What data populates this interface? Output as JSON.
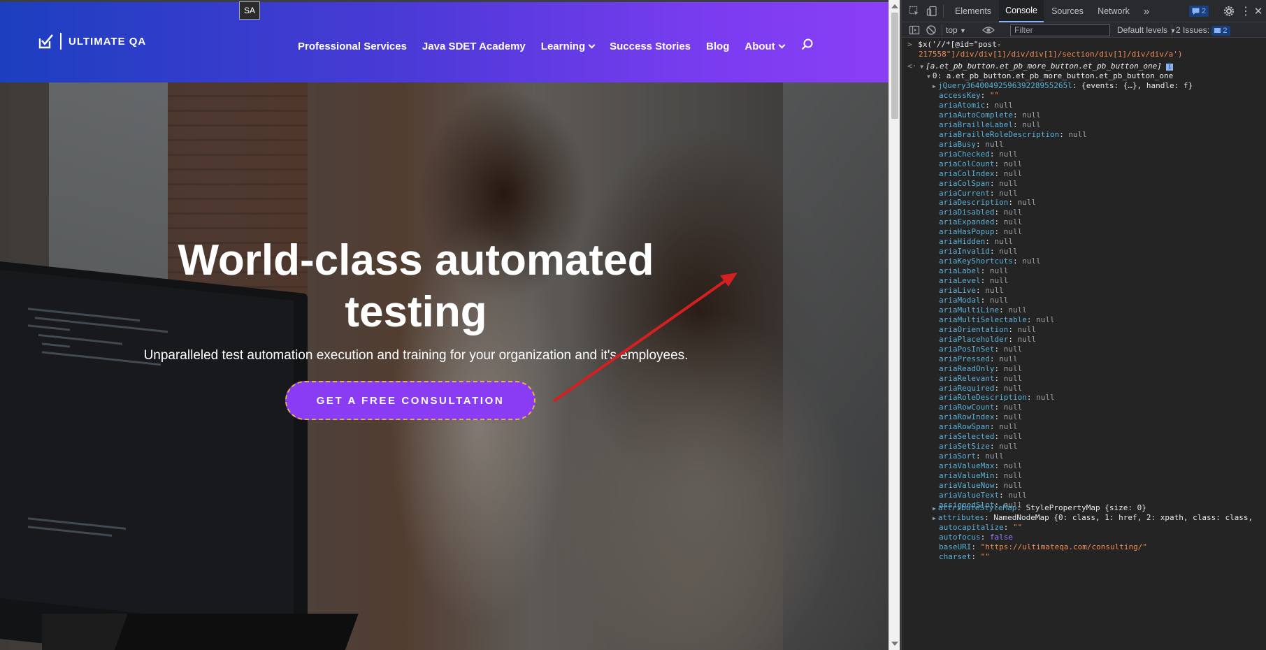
{
  "site": {
    "tooltip": "SA",
    "logo_text": "ULTIMATE QA",
    "nav": [
      {
        "label": "Professional Services",
        "has_dropdown": false
      },
      {
        "label": "Java SDET Academy",
        "has_dropdown": false
      },
      {
        "label": "Learning",
        "has_dropdown": true
      },
      {
        "label": "Success Stories",
        "has_dropdown": false
      },
      {
        "label": "Blog",
        "has_dropdown": false
      },
      {
        "label": "About",
        "has_dropdown": true
      }
    ],
    "hero_title": "World-class automated testing",
    "hero_subtitle": "Unparalleled test automation execution and training for your organization and it's employees.",
    "cta_label": "GET A FREE CONSULTATION",
    "colors": {
      "header_start": "#1c3fbf",
      "header_end": "#8a3ff5",
      "cta": "#8a3cf5",
      "arrow": "#d42020"
    }
  },
  "devtools": {
    "tabs": [
      "Elements",
      "Console",
      "Sources",
      "Network"
    ],
    "active_tab": "Console",
    "messages_badge": "2",
    "context": "top",
    "filter_placeholder": "Filter",
    "levels": "Default levels",
    "issues_label": "2 Issues:",
    "issues_count": "2",
    "command_line1": "$x('//*[@id=\"post-",
    "command_line2": "217558\"]/div/div[1]/div/div[1]/section/div[1]/div/div/a')",
    "result_summary": "[a.et_pb_button.et_pb_more_button.et_pb_button_one]",
    "item0": "0: a.et_pb_button.et_pb_more_button.et_pb_button_one",
    "jquery_prop": "jQuery3640049259639228955265l",
    "jquery_val": "{events: {…}, handle: f}",
    "props": [
      {
        "name": "accessKey",
        "value": "\"\"",
        "type": "str"
      },
      {
        "name": "ariaAtomic",
        "value": "null",
        "type": "null"
      },
      {
        "name": "ariaAutoComplete",
        "value": "null",
        "type": "null"
      },
      {
        "name": "ariaBrailleLabel",
        "value": "null",
        "type": "null"
      },
      {
        "name": "ariaBrailleRoleDescription",
        "value": "null",
        "type": "null"
      },
      {
        "name": "ariaBusy",
        "value": "null",
        "type": "null"
      },
      {
        "name": "ariaChecked",
        "value": "null",
        "type": "null"
      },
      {
        "name": "ariaColCount",
        "value": "null",
        "type": "null"
      },
      {
        "name": "ariaColIndex",
        "value": "null",
        "type": "null"
      },
      {
        "name": "ariaColSpan",
        "value": "null",
        "type": "null"
      },
      {
        "name": "ariaCurrent",
        "value": "null",
        "type": "null"
      },
      {
        "name": "ariaDescription",
        "value": "null",
        "type": "null"
      },
      {
        "name": "ariaDisabled",
        "value": "null",
        "type": "null"
      },
      {
        "name": "ariaExpanded",
        "value": "null",
        "type": "null"
      },
      {
        "name": "ariaHasPopup",
        "value": "null",
        "type": "null"
      },
      {
        "name": "ariaHidden",
        "value": "null",
        "type": "null"
      },
      {
        "name": "ariaInvalid",
        "value": "null",
        "type": "null"
      },
      {
        "name": "ariaKeyShortcuts",
        "value": "null",
        "type": "null"
      },
      {
        "name": "ariaLabel",
        "value": "null",
        "type": "null"
      },
      {
        "name": "ariaLevel",
        "value": "null",
        "type": "null"
      },
      {
        "name": "ariaLive",
        "value": "null",
        "type": "null"
      },
      {
        "name": "ariaModal",
        "value": "null",
        "type": "null"
      },
      {
        "name": "ariaMultiLine",
        "value": "null",
        "type": "null"
      },
      {
        "name": "ariaMultiSelectable",
        "value": "null",
        "type": "null"
      },
      {
        "name": "ariaOrientation",
        "value": "null",
        "type": "null"
      },
      {
        "name": "ariaPlaceholder",
        "value": "null",
        "type": "null"
      },
      {
        "name": "ariaPosInSet",
        "value": "null",
        "type": "null"
      },
      {
        "name": "ariaPressed",
        "value": "null",
        "type": "null"
      },
      {
        "name": "ariaReadOnly",
        "value": "null",
        "type": "null"
      },
      {
        "name": "ariaRelevant",
        "value": "null",
        "type": "null"
      },
      {
        "name": "ariaRequired",
        "value": "null",
        "type": "null"
      },
      {
        "name": "ariaRoleDescription",
        "value": "null",
        "type": "null"
      },
      {
        "name": "ariaRowCount",
        "value": "null",
        "type": "null"
      },
      {
        "name": "ariaRowIndex",
        "value": "null",
        "type": "null"
      },
      {
        "name": "ariaRowSpan",
        "value": "null",
        "type": "null"
      },
      {
        "name": "ariaSelected",
        "value": "null",
        "type": "null"
      },
      {
        "name": "ariaSetSize",
        "value": "null",
        "type": "null"
      },
      {
        "name": "ariaSort",
        "value": "null",
        "type": "null"
      },
      {
        "name": "ariaValueMax",
        "value": "null",
        "type": "null"
      },
      {
        "name": "ariaValueMin",
        "value": "null",
        "type": "null"
      },
      {
        "name": "ariaValueNow",
        "value": "null",
        "type": "null"
      },
      {
        "name": "ariaValueText",
        "value": "null",
        "type": "null"
      },
      {
        "name": "assignedSlot",
        "value": "null",
        "type": "null"
      }
    ],
    "attributeStyleMap": "StylePropertyMap {size: 0}",
    "attributes": "NamedNodeMap {0: class, 1: href, 2: xpath, class: class,",
    "autocapitalize": "\"\"",
    "autofocus": "false",
    "baseURI": "\"https://ultimateqa.com/consulting/\"",
    "charset": "\"\""
  }
}
